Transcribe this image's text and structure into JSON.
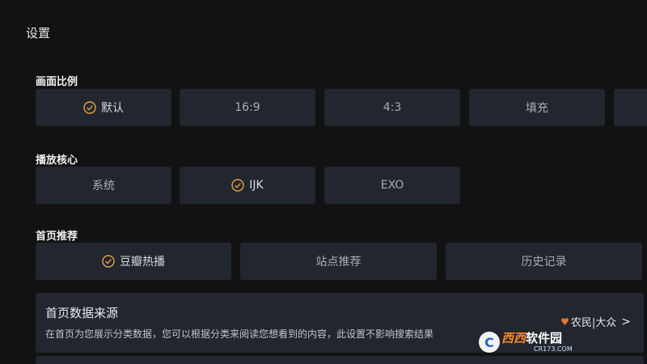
{
  "page": {
    "title": "设置"
  },
  "aspect_ratio": {
    "heading": "画面比例",
    "options": [
      {
        "label": "默认",
        "selected": true
      },
      {
        "label": "16:9",
        "selected": false
      },
      {
        "label": "4:3",
        "selected": false
      },
      {
        "label": "填充",
        "selected": false
      },
      {
        "label": "",
        "selected": false
      }
    ]
  },
  "player_core": {
    "heading": "播放核心",
    "options": [
      {
        "label": "系统",
        "selected": false
      },
      {
        "label": "IJK",
        "selected": true
      },
      {
        "label": "EXO",
        "selected": false
      }
    ]
  },
  "home_recommend": {
    "heading": "首页推荐",
    "options": [
      {
        "label": "豆瓣热播",
        "selected": true
      },
      {
        "label": "站点推荐",
        "selected": false
      },
      {
        "label": "历史记录",
        "selected": false
      }
    ]
  },
  "home_source": {
    "title": "首页数据来源",
    "description": "在首页为您展示分类数据，您可以根据分类来阅读您想看到的内容，此设置不影响搜索结果",
    "value": "农民|大众",
    "value_chevron": ">"
  },
  "watermark": {
    "badge": "C",
    "brand": "西西",
    "suffix": "软件园",
    "sub": "CR173.COM"
  },
  "colors": {
    "background": "#121212",
    "option_bg": "#22262f",
    "accent": "#e9a23b"
  }
}
